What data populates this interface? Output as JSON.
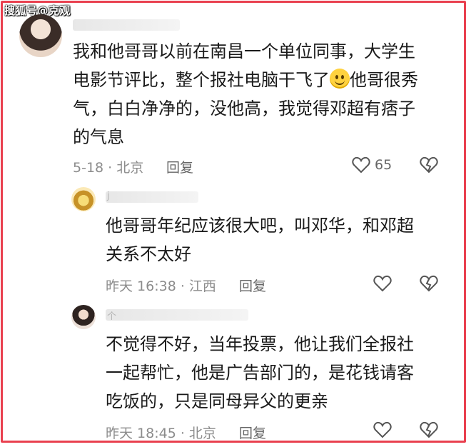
{
  "watermark": "搜狐号@克观",
  "comments": [
    {
      "username_glyph": "",
      "text_before_emoji": "我和他哥哥以前在南昌一个单位同事，大学生\n电影节评比，整个报社电脑干飞了",
      "text_after_emoji": "他哥很秀\n气，白白净净的，没他高，我觉得邓超有痞子\n的气息",
      "meta": "5-18 · 北京",
      "reply_label": "回复",
      "like_count": "65"
    },
    {
      "username_glyph": "j",
      "text": "他哥哥年纪应该很大吧，叫邓华，和邓超\n关系不太好",
      "meta": "昨天 16:38 · 江西",
      "reply_label": "回复"
    },
    {
      "username_glyph": "个",
      "text": "不觉得不好，当年投票，他让我们全报社\n一起帮忙，他是广告部门的，是花钱请客\n吃饭的，只是同母异父的更亲",
      "meta": "昨天 18:45 · 北京",
      "reply_label": "回复"
    }
  ],
  "colors": {
    "frame": "#e9404f",
    "text": "#1a1a1a",
    "meta": "#8c8c8c"
  },
  "icons": [
    "heart-icon",
    "dislike-heart-icon",
    "smile-emoji-icon"
  ]
}
